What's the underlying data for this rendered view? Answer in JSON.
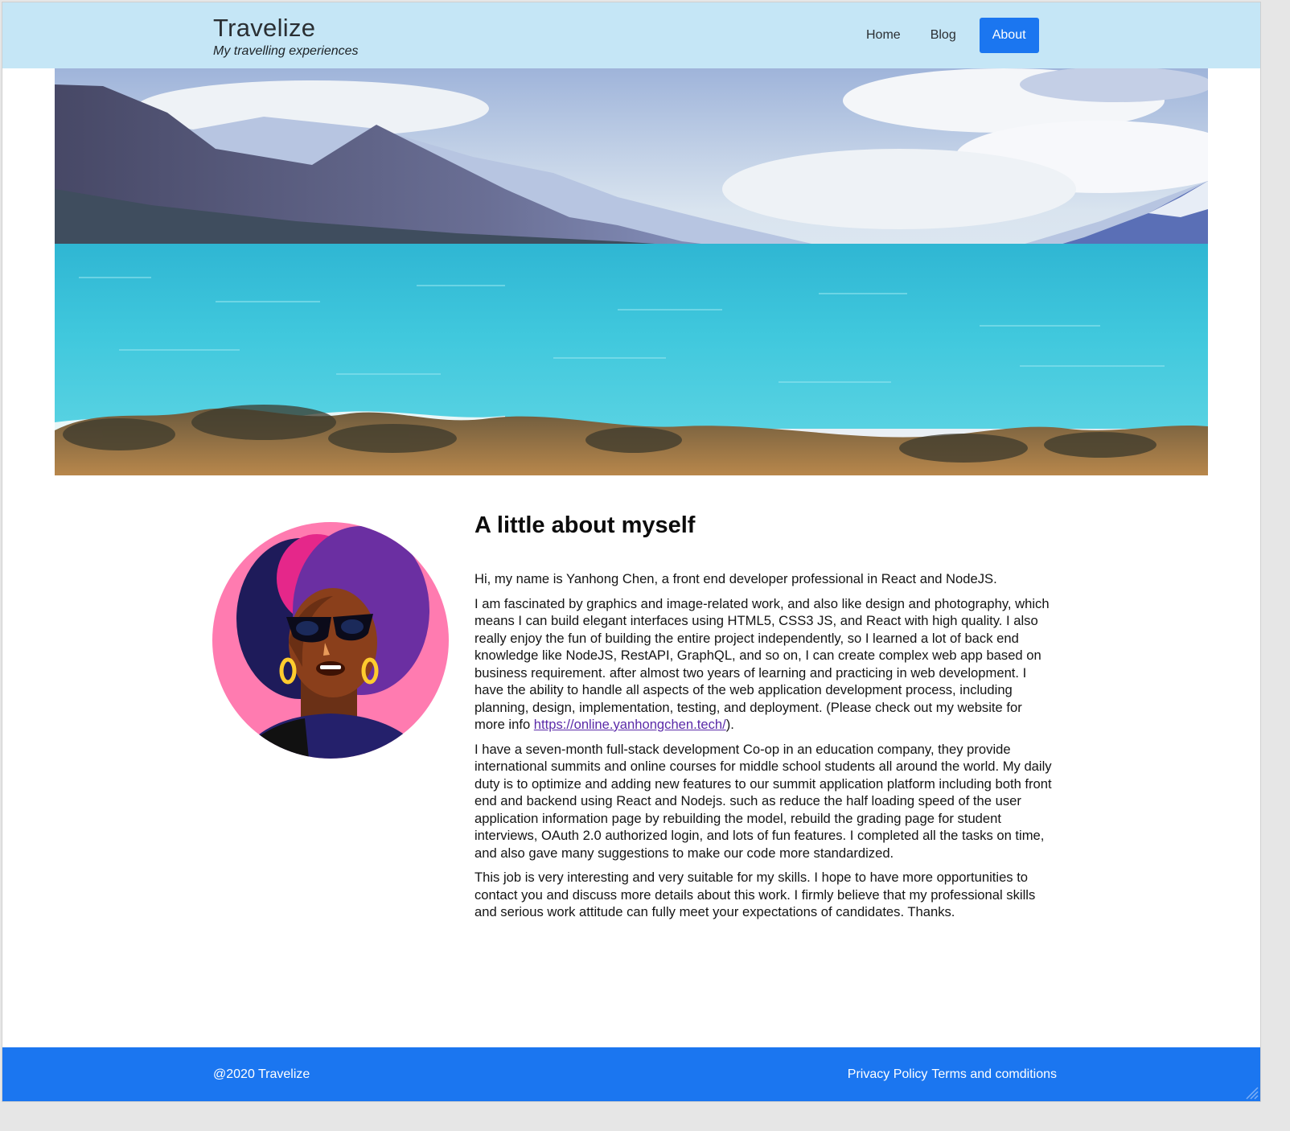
{
  "header": {
    "title": "Travelize",
    "tagline": "My travelling experiences",
    "nav": [
      {
        "label": "Home"
      },
      {
        "label": "Blog"
      },
      {
        "label": "About"
      }
    ],
    "active_nav": "About",
    "background": "#c5e6f6",
    "accent": "#1b76f0"
  },
  "hero": {
    "image": "lake-mountains-landscape",
    "colors": {
      "water": "#3cc5db",
      "sky": "#dbe8f1",
      "mountains": "#5b628a"
    }
  },
  "about": {
    "heading": "A little about myself",
    "avatar_icon": "woman-sunglasses-avatar",
    "p1": "Hi, my name is Yanhong Chen, a front end developer professional in React and NodeJS.",
    "p2_text": "I am fascinated by graphics and image-related work, and also like design and photography, which means I can build elegant interfaces using HTML5, CSS3 JS, and React with high quality. I also really enjoy the fun of building the entire project independently, so I learned a lot of back end knowledge like NodeJS, RestAPI, GraphQL, and so on, I can create complex web app based on business requirement. after almost two years of learning and practicing in web development. I have the ability to handle all aspects of the web application development process, including planning, design, implementation, testing, and deployment. (Please check out my website for more info ",
    "p2_link": "https://online.yanhongchen.tech/",
    "p2_end": ").",
    "p3": "I have a seven-month full-stack development Co-op in an education company, they provide international summits and online courses for middle school students all around the world. My daily duty is to optimize and adding new features to our summit application platform including both front end and backend using React and Nodejs. such as reduce the half loading speed of the user application information page by rebuilding the model, rebuild the grading page for student interviews, OAuth 2.0 authorized login, and lots of fun features. I completed all the tasks on time, and also gave many suggestions to make our code more standardized.",
    "p4": "This job is very interesting and very suitable for my skills. I hope to have more opportunities to contact you and discuss more details about this work. I firmly believe that my professional skills and serious work attitude can fully meet your expectations of candidates. Thanks."
  },
  "footer": {
    "copyright": "@2020 Travelize",
    "privacy": "Privacy Policy",
    "terms": "Terms and comditions",
    "background": "#1b76f0"
  }
}
